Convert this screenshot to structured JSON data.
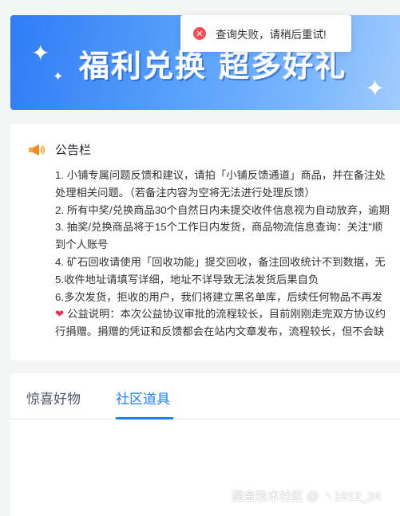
{
  "banner": {
    "title": "福利兑换  超多好礼"
  },
  "toast": {
    "icon": "error-circle-icon",
    "message": "查询失败，请稍后重试!"
  },
  "notice": {
    "title": "公告栏",
    "icon": "megaphone-icon",
    "lines": [
      "1. 小铺专属问题反馈和建议，请拍「小铺反馈通道」商品，并在备注处",
      "处理相关问题。（若备注内容为空将无法进行处理反馈）",
      "2. 所有中奖/兑换商品30个自然日内未提交收件信息视为自动放弃，逾期",
      "3. 抽奖/兑换商品将于15个工作日内发货，商品物流信息查询：关注\"顺",
      "到个人账号",
      "4. 矿石回收请使用「回收功能」提交回收，备注回收统计不到数据，无",
      "5.收件地址请填写详细，地址不详导致无法发货后果自负",
      "6.多次发货，拒收的用户，我们将建立黑名单库，后续任何物品不再发",
      "公益说明：本次公益协议审批的流程较长，目前刚刚走完双方协议约",
      "行捐赠。捐赠的凭证和反馈都会在站内文章发布，流程较长，但不会缺"
    ]
  },
  "tabs": [
    {
      "label": "惊喜好物",
      "active": false
    },
    {
      "label": "社区道具",
      "active": true
    }
  ],
  "watermark": "掘金技术社区 @ 丶1912_24",
  "colors": {
    "accent": "#1e80ff",
    "error": "#f24e4e",
    "heart": "#e8344d"
  }
}
